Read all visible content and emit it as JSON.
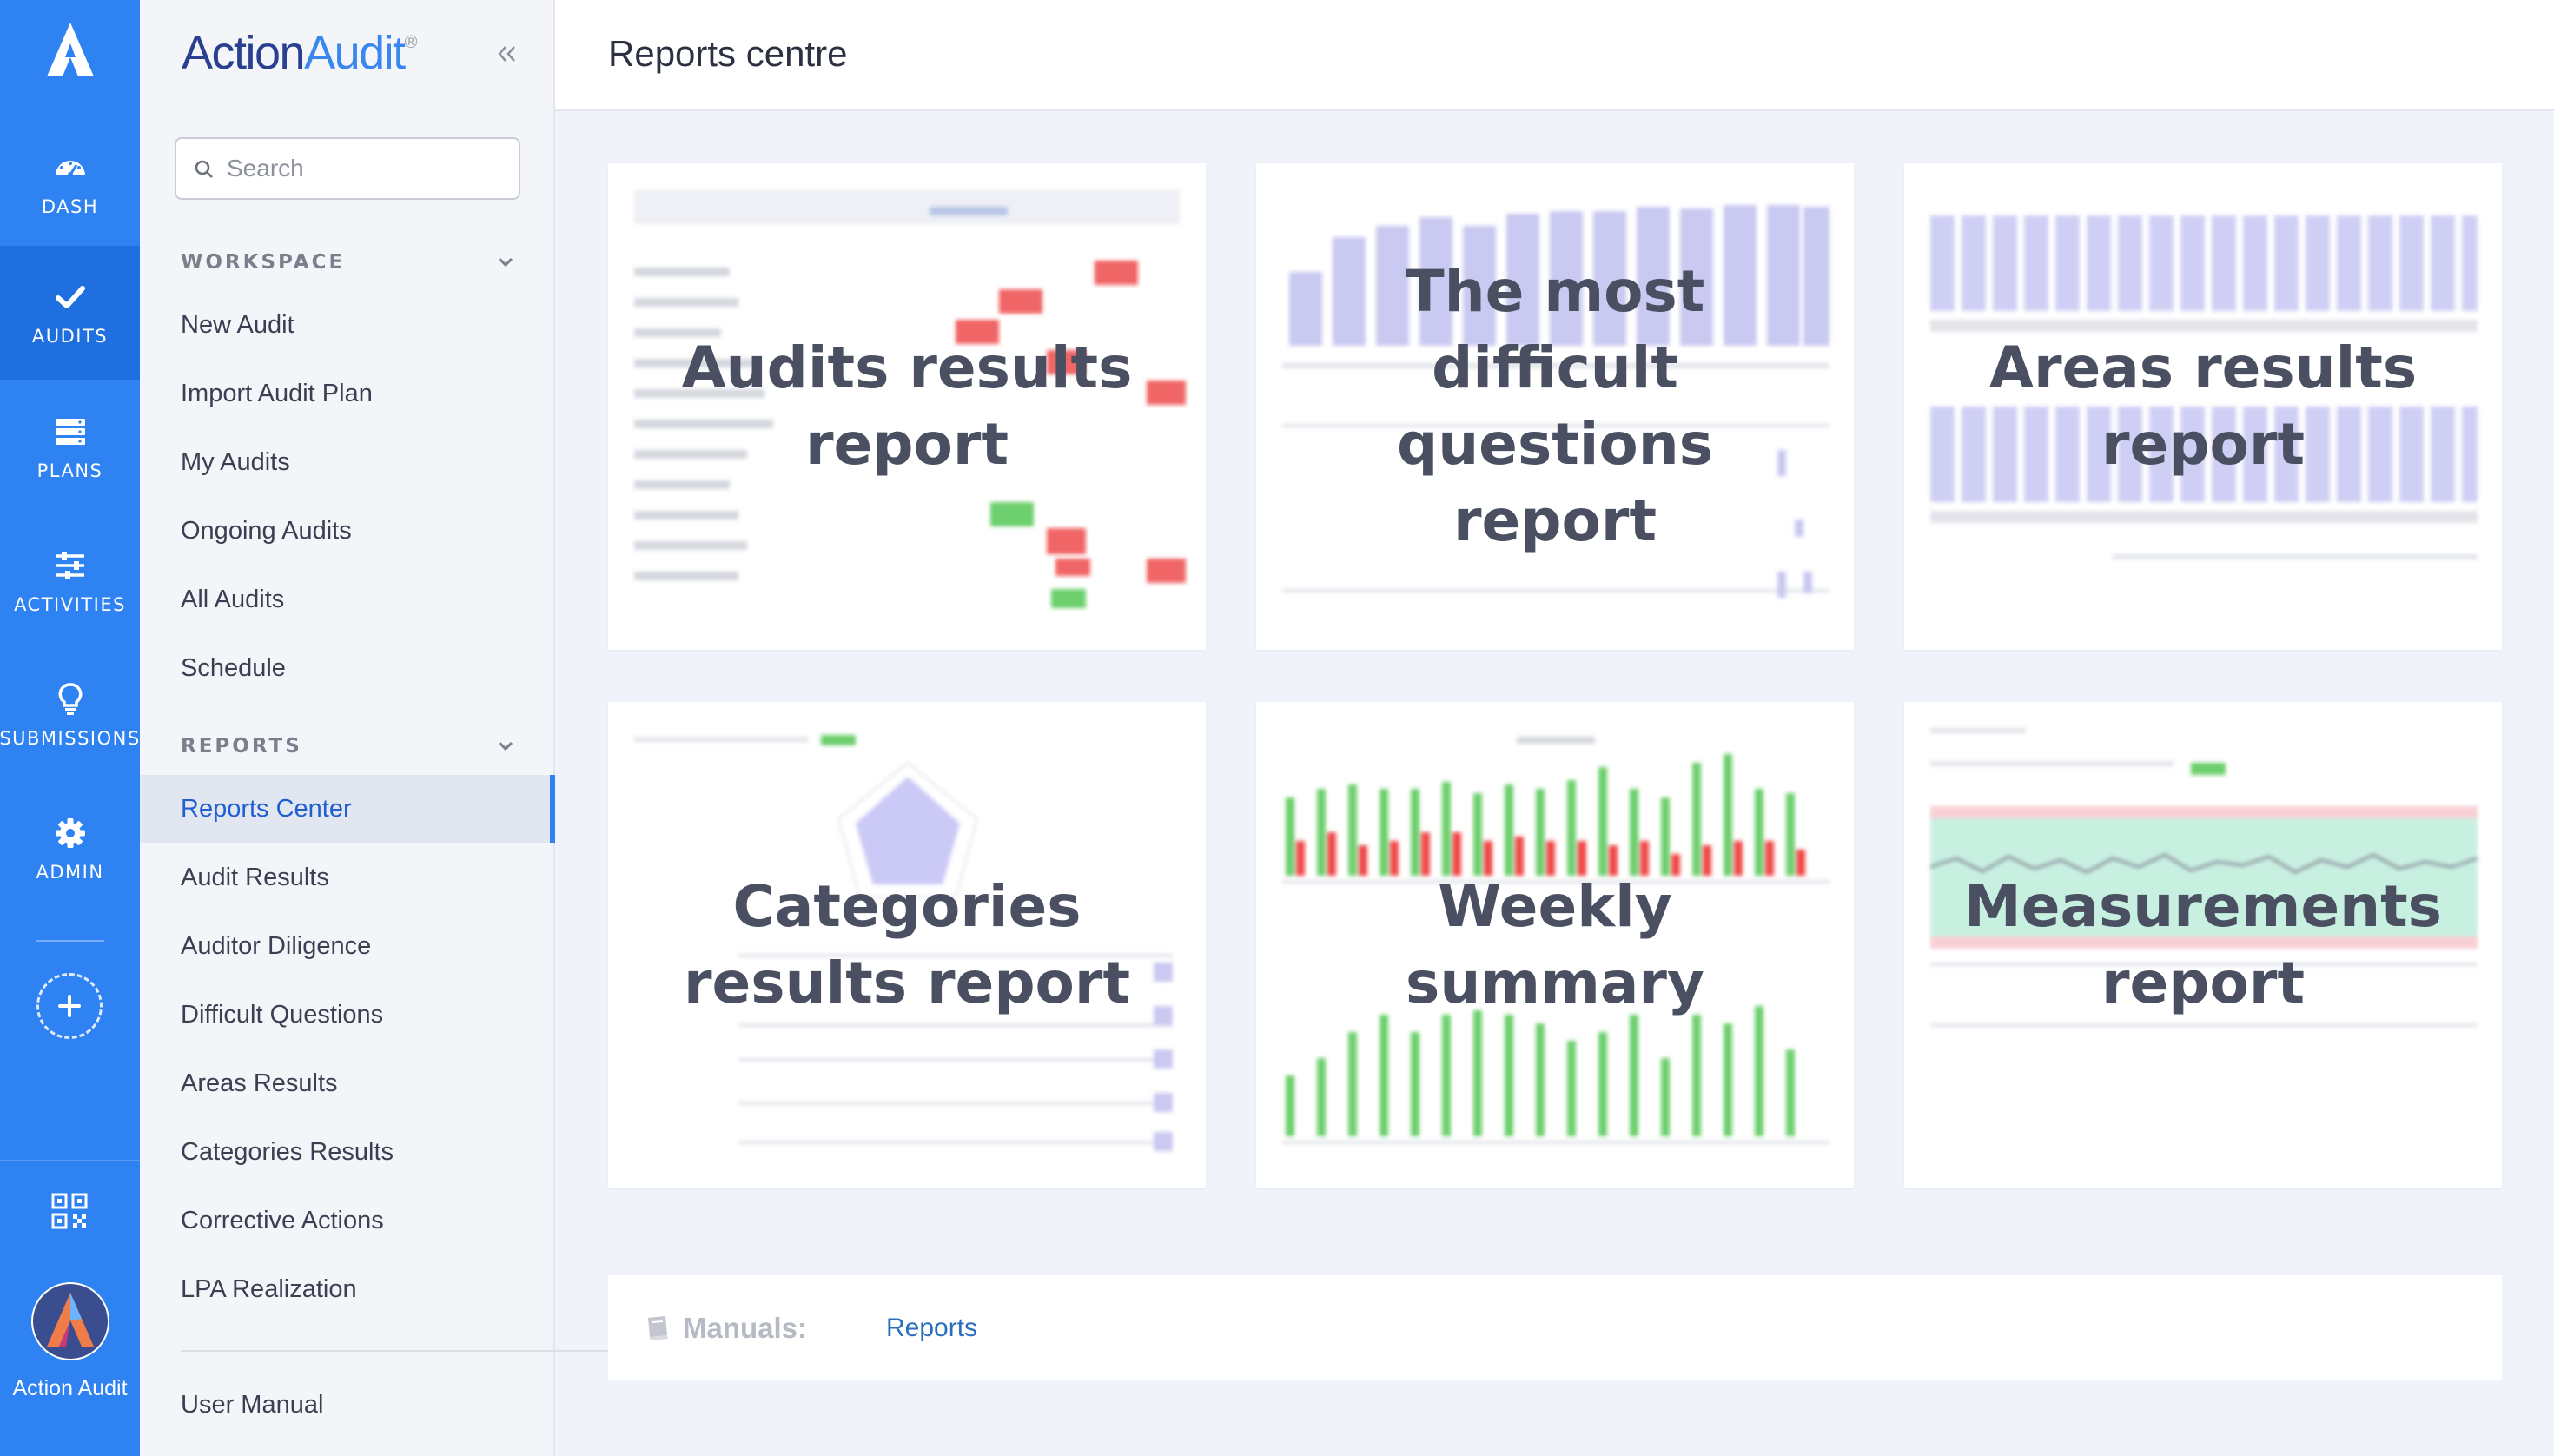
{
  "rail": {
    "items": [
      {
        "label": "DASH",
        "icon": "dashboard-gauge-icon"
      },
      {
        "label": "AUDITS",
        "icon": "checkmark-icon"
      },
      {
        "label": "PLANS",
        "icon": "stack-icon"
      },
      {
        "label": "ACTIVITIES",
        "icon": "sliders-icon"
      },
      {
        "label": "SUBMISSIONS",
        "icon": "lightbulb-icon"
      },
      {
        "label": "ADMIN",
        "icon": "gear-icon"
      }
    ],
    "user_name": "Action Audit",
    "accent": "#2e82f2"
  },
  "brand": {
    "part1": "Action",
    "part2": "Audit",
    "reg": "®"
  },
  "search": {
    "placeholder": "Search"
  },
  "workspace": {
    "title": "WORKSPACE",
    "items": [
      "New Audit",
      "Import Audit Plan",
      "My Audits",
      "Ongoing Audits",
      "All Audits",
      "Schedule"
    ]
  },
  "reports": {
    "title": "REPORTS",
    "items": [
      "Reports Center",
      "Audit Results",
      "Auditor Diligence",
      "Difficult Questions",
      "Areas Results",
      "Categories Results",
      "Corrective Actions",
      "LPA Realization"
    ]
  },
  "footer_menu": {
    "user_manual": "User Manual"
  },
  "header": {
    "title": "Reports centre"
  },
  "cards": [
    {
      "title": "Audits results report"
    },
    {
      "title": "The most difficult questions report"
    },
    {
      "title": "Areas results report"
    },
    {
      "title": "Categories results report"
    },
    {
      "title": "Weekly summary"
    },
    {
      "title": "Measurements report"
    }
  ],
  "manuals": {
    "label": "Manuals:",
    "link": "Reports"
  }
}
